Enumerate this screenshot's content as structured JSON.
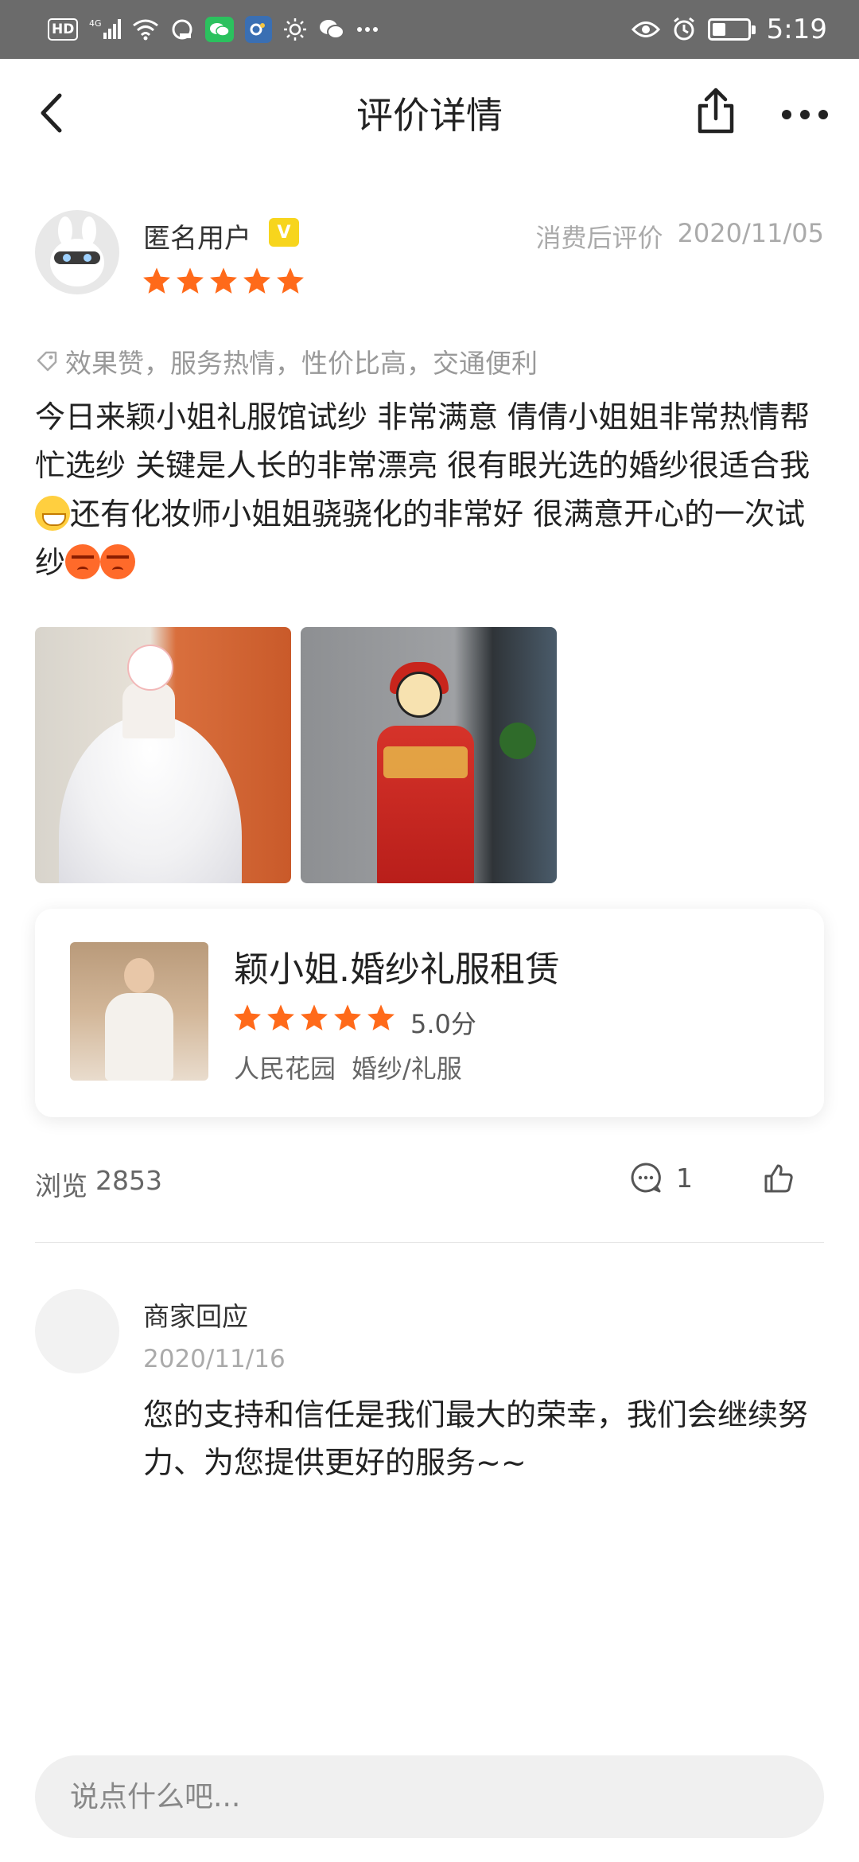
{
  "status_bar": {
    "network": "4G",
    "hd_label": "HD",
    "time": "5:19",
    "battery_level": 0.4,
    "icons": [
      "hd-icon",
      "signal-icon",
      "wifi-icon",
      "wechat-icon",
      "app-icon",
      "brightness-icon",
      "wechat-chat-icon",
      "more-dots-icon",
      "eye-icon",
      "alarm-icon",
      "battery-icon"
    ]
  },
  "nav": {
    "title": "评价详情",
    "back_icon": "chevron-left-icon",
    "share_icon": "share-icon",
    "more_icon": "more-dots-icon"
  },
  "review": {
    "username": "匿名用户",
    "vip_badge": "V",
    "meta_label": "消费后评价",
    "date": "2020/11/05",
    "rating": 5,
    "tags": "效果赞，服务热情，性价比高，交通便利",
    "text_1": "今日来颖小姐礼服馆试纱 非常满意 倩倩小姐姐非常热情帮忙选纱 关键是人长的非常漂亮 很有眼光选的婚纱很适合我",
    "text_2": "还有化妆师小姐姐骁骁化的非常好 很满意开心的一次试纱",
    "photos": [
      "wedding-gown-photo",
      "red-xiuhe-dress-photo"
    ]
  },
  "shop": {
    "name": "颖小姐.婚纱礼服租赁",
    "rating": 5,
    "score": "5.0分",
    "area": "人民花园",
    "category": "婚纱/礼服"
  },
  "stats": {
    "views_label": "浏览",
    "views": "2853",
    "comments": "1"
  },
  "reply": {
    "label": "商家回应",
    "date": "2020/11/16",
    "text": "您的支持和信任是我们最大的荣幸，我们会继续努力、为您提供更好的服务~~"
  },
  "input": {
    "placeholder": "说点什么吧..."
  },
  "colors": {
    "star": "#ff6a1a",
    "status_bar_bg": "#6b6b6b",
    "vip_badge": "#f7d51d"
  }
}
